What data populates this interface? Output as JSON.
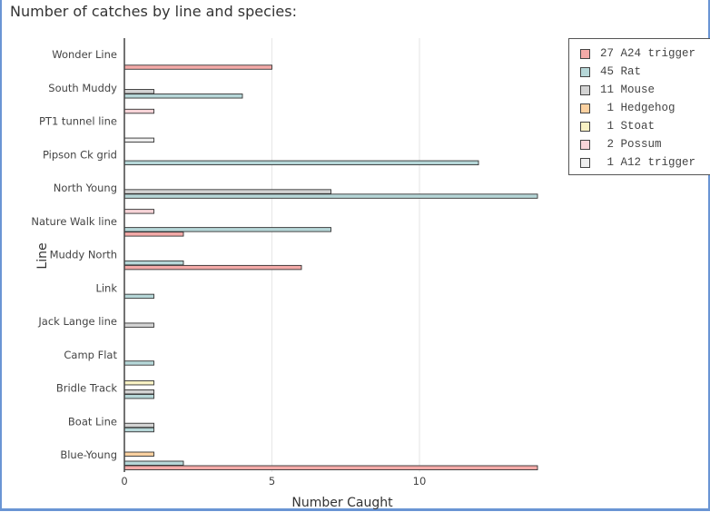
{
  "title": "Number of catches by line and species:",
  "chart_data": {
    "type": "bar",
    "orientation": "horizontal",
    "title": "Number of catches by line and species:",
    "xlabel": "Number Caught",
    "ylabel": "Line",
    "xlim": [
      0,
      14
    ],
    "xticks": [
      0,
      5,
      10
    ],
    "grid": true,
    "legend_position": "top-right",
    "categories": [
      "Wonder Line",
      "South Muddy",
      "PT1 tunnel line",
      "Pipson Ck grid",
      "North Young",
      "Nature Walk line",
      "Muddy North",
      "Link",
      "Jack Lange line",
      "Camp Flat",
      "Bridle Track",
      "Boat Line",
      "Blue-Young"
    ],
    "series": [
      {
        "name": "A24 trigger",
        "total": 27,
        "color": "#f4aaa8",
        "values": [
          5,
          0,
          0,
          0,
          0,
          2,
          6,
          0,
          0,
          0,
          0,
          0,
          14
        ]
      },
      {
        "name": "Rat",
        "total": 45,
        "color": "#b6d7d8",
        "values": [
          0,
          4,
          0,
          12,
          14,
          7,
          2,
          1,
          0,
          1,
          1,
          1,
          2
        ]
      },
      {
        "name": "Mouse",
        "total": 11,
        "color": "#d3d3d3",
        "values": [
          0,
          1,
          0,
          0,
          7,
          0,
          0,
          0,
          1,
          0,
          1,
          1,
          0
        ]
      },
      {
        "name": "Hedgehog",
        "total": 1,
        "color": "#fcd1a0",
        "values": [
          0,
          0,
          0,
          0,
          0,
          0,
          0,
          0,
          0,
          0,
          0,
          0,
          1
        ]
      },
      {
        "name": "Stoat",
        "total": 1,
        "color": "#f8f1c4",
        "values": [
          0,
          0,
          0,
          0,
          0,
          0,
          0,
          0,
          0,
          0,
          1,
          0,
          0
        ]
      },
      {
        "name": "Possum",
        "total": 2,
        "color": "#f7d4d8",
        "values": [
          0,
          0,
          1,
          0,
          0,
          1,
          0,
          0,
          0,
          0,
          0,
          0,
          0
        ]
      },
      {
        "name": "A12 trigger",
        "total": 1,
        "color": "#eeeeee",
        "values": [
          0,
          0,
          0,
          1,
          0,
          0,
          0,
          0,
          0,
          0,
          0,
          0,
          0
        ]
      }
    ]
  },
  "legend": {
    "items": [
      {
        "label": "27 A24 trigger",
        "color": "#f4aaa8"
      },
      {
        "label": "45 Rat",
        "color": "#b6d7d8"
      },
      {
        "label": "11 Mouse",
        "color": "#d3d3d3"
      },
      {
        "label": " 1 Hedgehog",
        "color": "#fcd1a0"
      },
      {
        "label": " 1 Stoat",
        "color": "#f8f1c4"
      },
      {
        "label": " 2 Possum",
        "color": "#f7d4d8"
      },
      {
        "label": " 1 A12 trigger",
        "color": "#eeeeee"
      }
    ]
  }
}
